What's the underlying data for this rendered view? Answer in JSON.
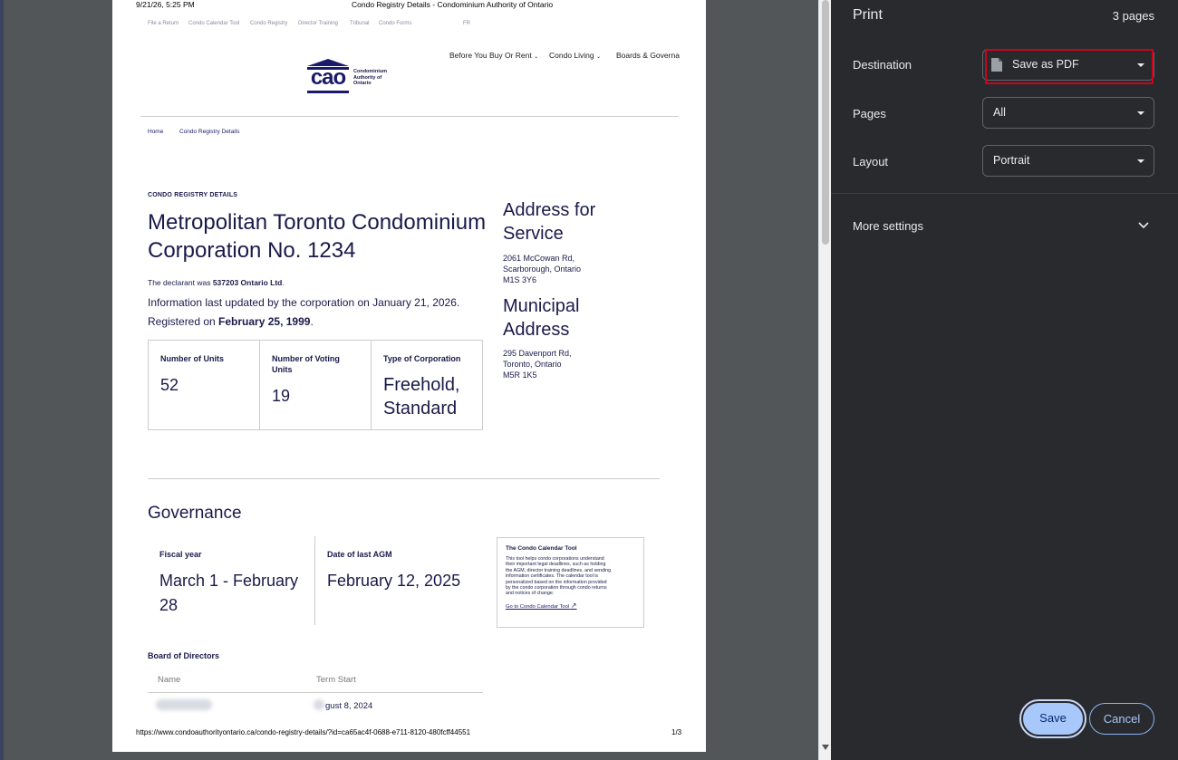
{
  "print_header": {
    "datetime": "9/21/26, 5:25 PM",
    "page_title": "Condo Registry Details - Condominium Authority of Ontario"
  },
  "print_footer": {
    "url": "https://www.condoauthorityontario.ca/condo-registry-details/?id=ca65ac4f-0688-e711-8120-480fcff44551",
    "page_num": "1/3"
  },
  "site": {
    "top_links": [
      "File a Return",
      "Condo Calendar Tool",
      "Condo Registry",
      "Director Training",
      "Tribunal",
      "Condo Forms",
      "FR"
    ],
    "logo_text": "cao",
    "logo_name": [
      "Condominium",
      "Authority of",
      "Ontario"
    ],
    "main_nav": [
      "Before You Buy Or Rent",
      "Condo Living",
      "Boards & Governar"
    ],
    "breadcrumb": [
      "Home",
      "Condo Registry Details"
    ]
  },
  "condo": {
    "eyebrow": "CONDO REGISTRY DETAILS",
    "title_line1": "Metropolitan Toronto Condominium",
    "title_line2": "Corporation No. 1234",
    "declarant_prefix": "The declarant was ",
    "declarant_name": "537203 Ontario Ltd",
    "declarant_suffix": ".",
    "updated_text": "Information last updated by the corporation on January 21, 2026.",
    "registered_prefix": "Registered on ",
    "registered_date": "February 25, 1999",
    "registered_suffix": ".",
    "stats": [
      {
        "label": "Number of Units",
        "value": "52"
      },
      {
        "label_line1": "Number of Voting",
        "label_line2": "Units",
        "value": "19"
      },
      {
        "label": "Type of Corporation",
        "value_line1": "Freehold,",
        "value_line2": "Standard"
      }
    ],
    "service_address": {
      "heading_line1": "Address for",
      "heading_line2": "Service",
      "lines": [
        "2061 McCowan Rd,",
        "Scarborough, Ontario",
        "M1S 3Y6"
      ]
    },
    "municipal_address": {
      "heading_line1": "Municipal",
      "heading_line2": "Address",
      "lines": [
        "295 Davenport Rd,",
        "Toronto, Ontario",
        "M5R 1K5"
      ]
    }
  },
  "governance": {
    "heading": "Governance",
    "fiscal_label": "Fiscal year",
    "fiscal_line1": "March 1 - February",
    "fiscal_line2": "28",
    "agm_label": "Date of last AGM",
    "agm_value": "February 12, 2025",
    "calendar_card": {
      "title": "The Condo Calendar Tool",
      "body_lines": [
        "This tool helps condo corporations understand",
        "their important legal deadlines, such as holding",
        "the AGM, director training deadlines, and sending",
        "information certificates. The calendar tool is",
        "personalized based on the information provided",
        "by the condo corporation through condo returns",
        "and notices of change."
      ],
      "link": "Go to Condo Calendar Tool"
    },
    "board_heading": "Board of Directors",
    "board_columns": [
      "Name",
      "Term Start"
    ],
    "board_first_row_term": "gust 8, 2024"
  },
  "print_panel": {
    "title": "Print",
    "pages_count": "3 pages",
    "destination_label": "Destination",
    "destination_value": "Save as PDF",
    "pages_label": "Pages",
    "pages_value": "All",
    "layout_label": "Layout",
    "layout_value": "Portrait",
    "more_settings": "More settings",
    "save_label": "Save",
    "cancel_label": "Cancel",
    "highlight_color": "#d0021b",
    "save_bg": "#a8c7fa",
    "save_text": "#062e6f",
    "cancel_text": "#a8c7fa"
  }
}
